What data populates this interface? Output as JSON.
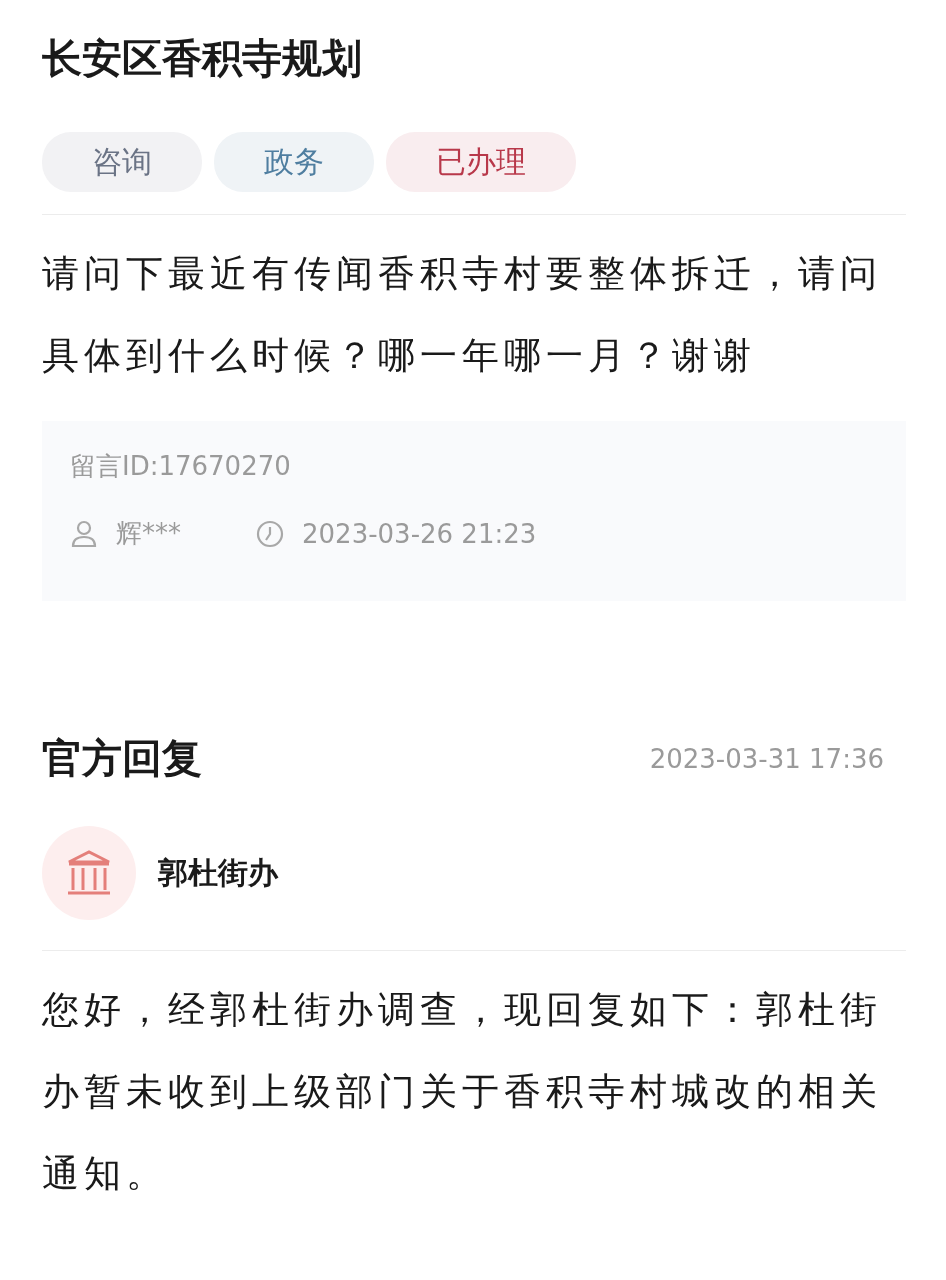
{
  "title": "长安区香积寺规划",
  "tags": [
    {
      "label": "咨询",
      "color": "#6a7385"
    },
    {
      "label": "政务",
      "color": "#4f7ea0"
    },
    {
      "label": "已办理",
      "color": "#b8384a"
    }
  ],
  "question": "请问下最近有传闻香积寺村要整体拆迁，请问具体到什么时候？哪一年哪一月？谢谢",
  "message_meta": {
    "message_id": "留言ID:17670270",
    "user": "辉***",
    "time": "2023-03-26 21:23"
  },
  "reply": {
    "heading": "官方回复",
    "time": "2023-03-31 17:36",
    "department": "郭杜街办",
    "text": "您好，经郭杜街办调查，现回复如下：郭杜街办暂未收到上级部门关于香积寺村城改的相关通知。"
  }
}
